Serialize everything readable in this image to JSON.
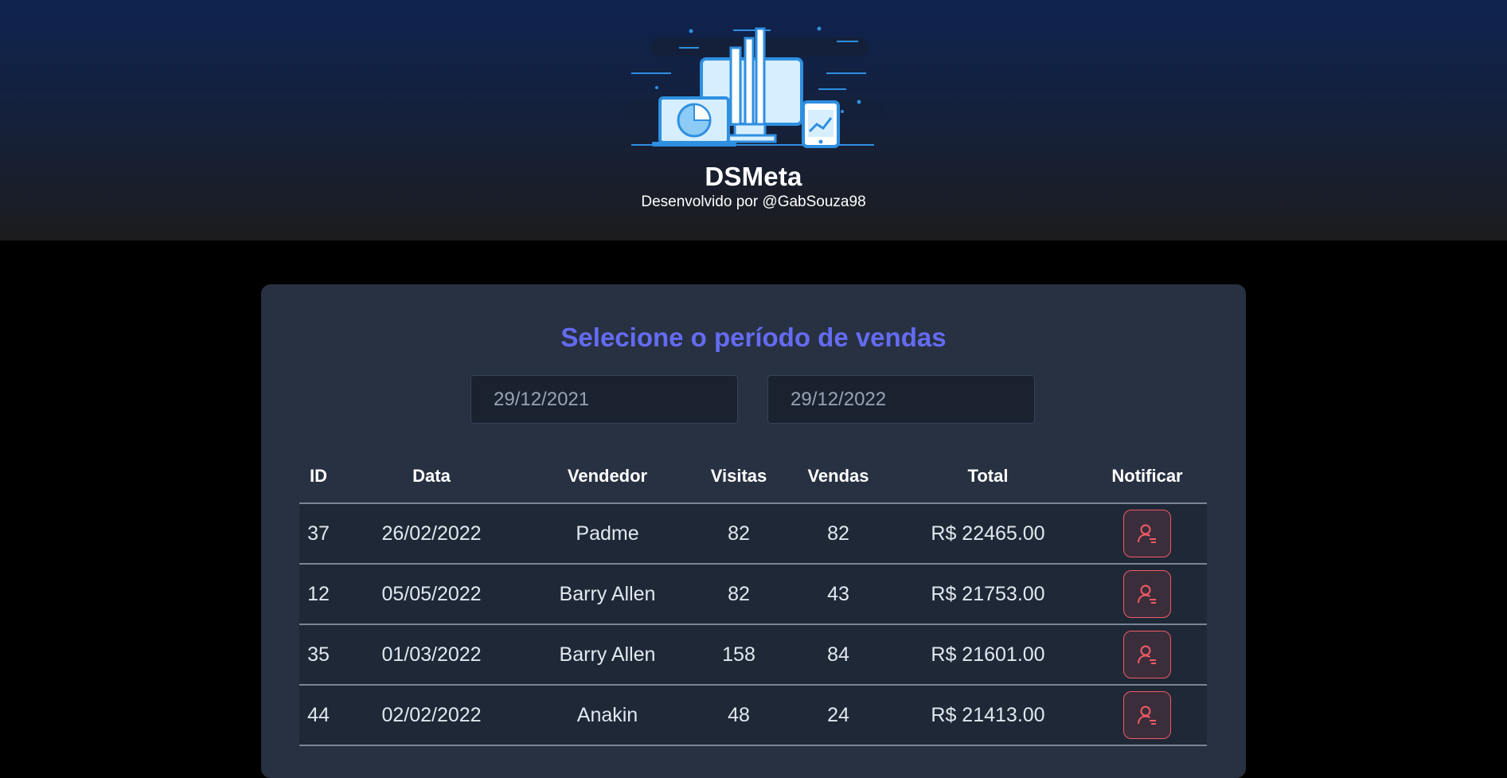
{
  "header": {
    "title": "DSMeta",
    "subtitle": "Desenvolvido por @GabSouza98"
  },
  "sales": {
    "title": "Selecione o período de vendas",
    "date_min": "29/12/2021",
    "date_max": "29/12/2022",
    "columns": [
      "ID",
      "Data",
      "Vendedor",
      "Visitas",
      "Vendas",
      "Total",
      "Notificar"
    ],
    "rows": [
      {
        "id": "37",
        "date": "26/02/2022",
        "seller": "Padme",
        "visits": "82",
        "deals": "82",
        "total": "R$ 22465.00"
      },
      {
        "id": "12",
        "date": "05/05/2022",
        "seller": "Barry Allen",
        "visits": "82",
        "deals": "43",
        "total": "R$ 21753.00"
      },
      {
        "id": "35",
        "date": "01/03/2022",
        "seller": "Barry Allen",
        "visits": "158",
        "deals": "84",
        "total": "R$ 21601.00"
      },
      {
        "id": "44",
        "date": "02/02/2022",
        "seller": "Anakin",
        "visits": "48",
        "deals": "24",
        "total": "R$ 21413.00"
      }
    ]
  },
  "icons": {
    "logo": "dashboard-devices-illustration",
    "notify": "user-notify-icon"
  },
  "colors": {
    "accent": "#646CF2",
    "notify_red": "#F05A64",
    "card_bg": "#283142"
  }
}
